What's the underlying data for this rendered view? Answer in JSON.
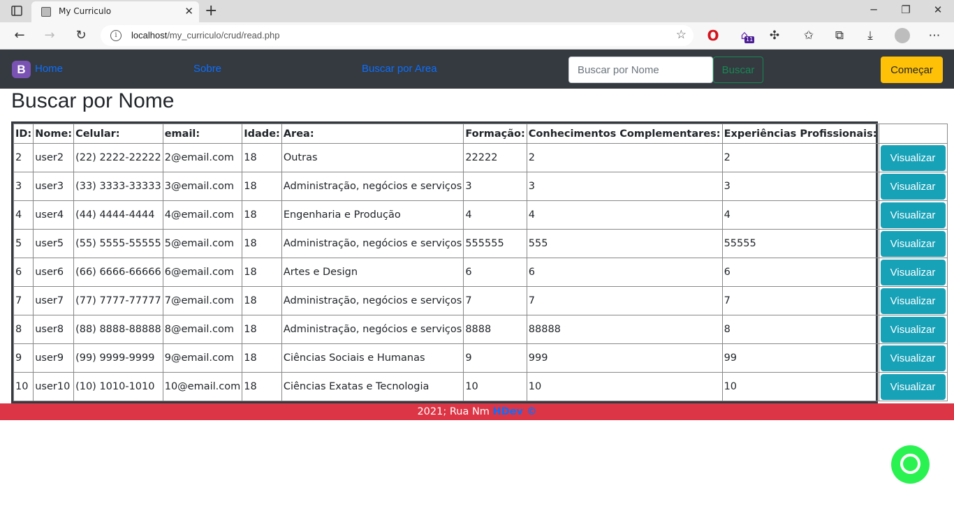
{
  "browser": {
    "tab_title": "My Curriculo",
    "url_host": "localhost",
    "url_path": "/my_curriculo/crud/read.php",
    "extension_badge": "11"
  },
  "navbar": {
    "brand_letter": "B",
    "links": [
      "Home",
      "Sobre",
      "Buscar por Area"
    ],
    "search_placeholder": "Buscar por Nome",
    "search_button": "Buscar",
    "start_button": "Começar"
  },
  "page": {
    "title": "Buscar por Nome"
  },
  "table": {
    "headers": [
      "ID:",
      "Nome:",
      "Celular:",
      "email:",
      "Idade:",
      "Area:",
      "Formação:",
      "Conhecimentos Complementares:",
      "Experiências Profissionais:",
      ""
    ],
    "action_label": "Visualizar",
    "rows": [
      [
        "2",
        "user2",
        "(22) 2222-22222",
        "2@email.com",
        "18",
        "Outras",
        "22222",
        "2",
        "2"
      ],
      [
        "3",
        "user3",
        "(33) 3333-33333",
        "3@email.com",
        "18",
        "Administração, negócios e serviços",
        "3",
        "3",
        "3"
      ],
      [
        "4",
        "user4",
        "(44) 4444-4444",
        "4@email.com",
        "18",
        "Engenharia e Produção",
        "4",
        "4",
        "4"
      ],
      [
        "5",
        "user5",
        "(55) 5555-55555",
        "5@email.com",
        "18",
        "Administração, negócios e serviços",
        "555555",
        "555",
        "55555"
      ],
      [
        "6",
        "user6",
        "(66) 6666-66666",
        "6@email.com",
        "18",
        "Artes e Design",
        "6",
        "6",
        "6"
      ],
      [
        "7",
        "user7",
        "(77) 7777-77777",
        "7@email.com",
        "18",
        "Administração, negócios e serviços",
        "7",
        "7",
        "7"
      ],
      [
        "8",
        "user8",
        "(88) 8888-88888",
        "8@email.com",
        "18",
        "Administração, negócios e serviços",
        "8888",
        "88888",
        "8"
      ],
      [
        "9",
        "user9",
        "(99) 9999-9999",
        "9@email.com",
        "18",
        "Ciências Sociais e Humanas",
        "9",
        "999",
        "99"
      ],
      [
        "10",
        "user10",
        "(10) 1010-1010",
        "10@email.com",
        "18",
        "Ciências Exatas e Tecnologia",
        "10",
        "10",
        "10"
      ]
    ]
  },
  "footer": {
    "text": "2021; Rua Nm ",
    "brand": "HDev ©"
  }
}
